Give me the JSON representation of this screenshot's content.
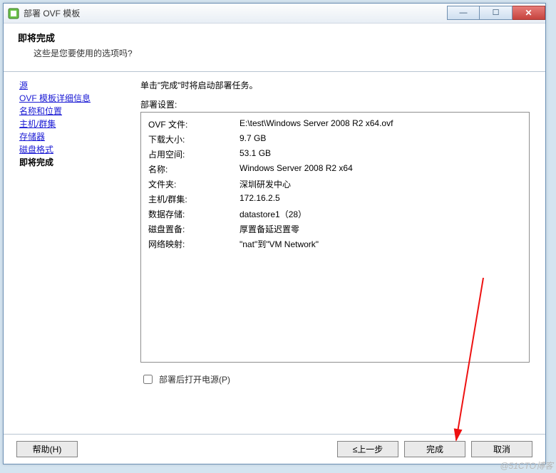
{
  "titlebar": {
    "title": "部署 OVF 模板"
  },
  "header": {
    "title": "即将完成",
    "subtitle": "这些是您要使用的选项吗?"
  },
  "sidebar": {
    "items": [
      {
        "label": "源",
        "current": false
      },
      {
        "label": "OVF 模板详细信息",
        "current": false
      },
      {
        "label": "名称和位置",
        "current": false
      },
      {
        "label": "主机/群集",
        "current": false
      },
      {
        "label": "存储器",
        "current": false
      },
      {
        "label": "磁盘格式",
        "current": false
      },
      {
        "label": "即将完成",
        "current": true
      }
    ]
  },
  "main": {
    "description": "单击\"完成\"时将启动部署任务。",
    "settings_label": "部署设置:",
    "rows": [
      {
        "k": "OVF 文件:",
        "v": "E:\\test\\Windows Server 2008 R2 x64.ovf"
      },
      {
        "k": "下载大小:",
        "v": "9.7 GB"
      },
      {
        "k": "占用空间:",
        "v": "53.1 GB"
      },
      {
        "k": "名称:",
        "v": "Windows Server 2008 R2 x64"
      },
      {
        "k": "文件夹:",
        "v": "深圳研发中心"
      },
      {
        "k": "主机/群集:",
        "v": "172.16.2.5"
      },
      {
        "k": "数据存储:",
        "v": "datastore1（28）"
      },
      {
        "k": "磁盘置备:",
        "v": "厚置备延迟置零"
      },
      {
        "k": "网络映射:",
        "v": "\"nat\"到\"VM Network\""
      }
    ],
    "poweron_label": "部署后打开电源(P)"
  },
  "footer": {
    "help": "帮助(H)",
    "back": "≤上一步",
    "finish": "完成",
    "cancel": "取消"
  },
  "watermark": "@51CTO博客"
}
